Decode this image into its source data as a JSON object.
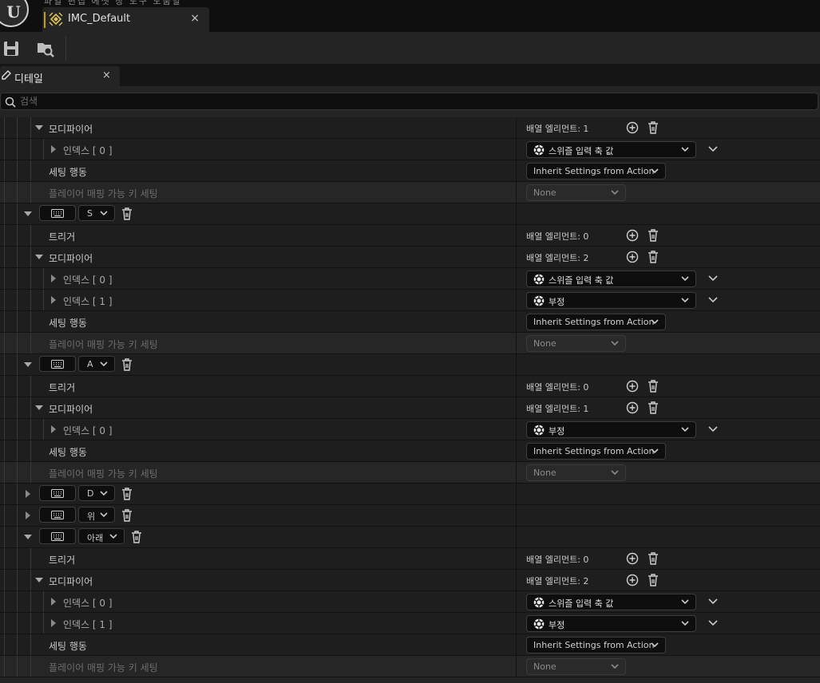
{
  "app": {
    "menu_trace": "파일  편집  에셋  창  도구  도움말"
  },
  "asset_tab": {
    "title": "IMC_Default",
    "close": "×"
  },
  "details": {
    "tab_label": "디테일",
    "tab_close": "×",
    "search_placeholder": "검색"
  },
  "rows": [
    {
      "kind": "modifier",
      "depth": 2,
      "label": "모디파이어",
      "value": "배열 엘리먼트: 1"
    },
    {
      "kind": "index",
      "label": "인덱스 [ 0 ]",
      "value": "스위즐 입력 축 값"
    },
    {
      "kind": "setting",
      "label": "세팅 행동",
      "value": "Inherit Settings from Action"
    },
    {
      "kind": "player",
      "label": "플레이어 매핑 가능 키 세팅",
      "value": "None"
    },
    {
      "kind": "key",
      "expanded": true,
      "key": "S"
    },
    {
      "kind": "trigger",
      "label": "트리거",
      "value": "배열 엘리먼트: 0"
    },
    {
      "kind": "modifier",
      "label": "모디파이어",
      "value": "배열 엘리먼트: 2"
    },
    {
      "kind": "index",
      "label": "인덱스 [ 0 ]",
      "value": "스위즐 입력 축 값"
    },
    {
      "kind": "index",
      "label": "인덱스 [ 1 ]",
      "value": "부정"
    },
    {
      "kind": "setting",
      "label": "세팅 행동",
      "value": "Inherit Settings from Action"
    },
    {
      "kind": "player",
      "label": "플레이어 매핑 가능 키 세팅",
      "value": "None"
    },
    {
      "kind": "key",
      "expanded": true,
      "key": "A"
    },
    {
      "kind": "trigger",
      "label": "트리거",
      "value": "배열 엘리먼트: 0"
    },
    {
      "kind": "modifier",
      "label": "모디파이어",
      "value": "배열 엘리먼트: 1"
    },
    {
      "kind": "index",
      "label": "인덱스 [ 0 ]",
      "value": "부정"
    },
    {
      "kind": "setting",
      "label": "세팅 행동",
      "value": "Inherit Settings from Action"
    },
    {
      "kind": "player",
      "label": "플레이어 매핑 가능 키 세팅",
      "value": "None"
    },
    {
      "kind": "key",
      "expanded": false,
      "key": "D"
    },
    {
      "kind": "key",
      "expanded": false,
      "key": "위"
    },
    {
      "kind": "key",
      "expanded": true,
      "key": "아래"
    },
    {
      "kind": "trigger",
      "label": "트리거",
      "value": "배열 엘리먼트: 0"
    },
    {
      "kind": "modifier",
      "label": "모디파이어",
      "value": "배열 엘리먼트: 2"
    },
    {
      "kind": "index",
      "label": "인덱스 [ 0 ]",
      "value": "스위즐 입력 축 값"
    },
    {
      "kind": "index",
      "label": "인덱스 [ 1 ]",
      "value": "부정"
    },
    {
      "kind": "setting",
      "label": "세팅 행동",
      "value": "Inherit Settings from Action"
    },
    {
      "kind": "player",
      "label": "플레이어 매핑 가능 키 세팅",
      "value": "None"
    }
  ],
  "icons": {
    "save": "save-icon",
    "browse": "browse-asset-icon",
    "keyboard": "keyboard-icon",
    "trash": "trash-icon",
    "add": "add-circle-icon",
    "modifier": "modifier-gear-icon"
  },
  "colors": {
    "asset_accent": "#c8a000",
    "panel_bg": "#242424",
    "row_bg": "#1e1e1e"
  }
}
